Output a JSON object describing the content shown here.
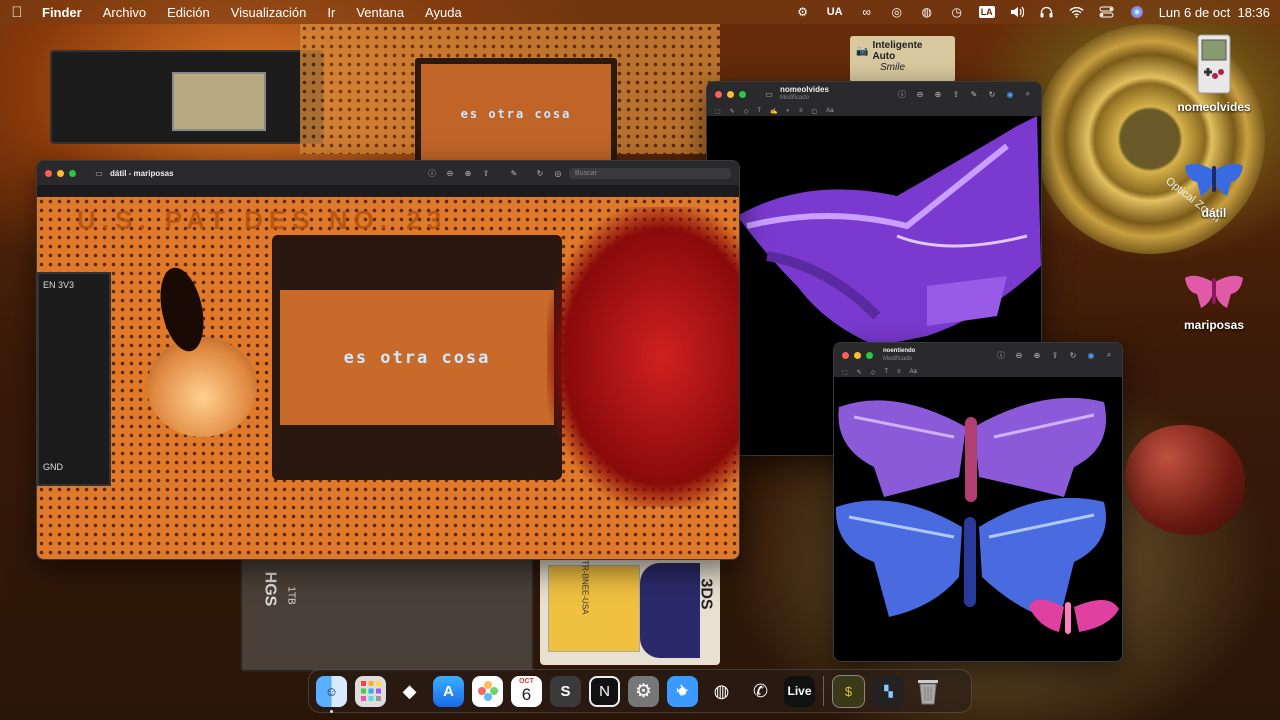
{
  "menubar": {
    "app": "Finder",
    "menus": [
      "Archivo",
      "Edición",
      "Visualización",
      "Ir",
      "Ventana",
      "Ayuda"
    ],
    "keyboard": "UA",
    "input_badge": "LA",
    "clock": "Lun 6 de oct  18:36",
    "status_icons": [
      "gear-icon",
      "input-source",
      "creative-cloud-icon",
      "airdrop-icon",
      "sony-icon",
      "time-machine-icon",
      "volume-icon",
      "headphones-icon",
      "wifi-icon",
      "control-center-icon",
      "siri-icon"
    ]
  },
  "scene": {
    "oled_small": "es otra cosa",
    "label_camera_1": "Inteligente",
    "label_camera_2": "Auto",
    "label_camera_3": "Smile",
    "label_zoom": "Optical Zoom",
    "label_3ds": "3DS",
    "label_hdd": "HGS",
    "label_hdd_cap": "1TB",
    "label_game": "CTR-BNEE-USA"
  },
  "window_main": {
    "title": "dátil - mariposas",
    "search_placeholder": "Buscar",
    "oled_text": "es otra cosa",
    "patent_text": "U.S. PAT DES NO. 23",
    "board_label": "EN 3V3",
    "board_label_2": "GND"
  },
  "window_nomeolvides": {
    "title": "nomeolvides",
    "subtitle": "Modificado"
  },
  "window_noentiendo": {
    "title": "noentiendo",
    "subtitle": "Modificado"
  },
  "desktop_icons": [
    {
      "label": "nomeolvides",
      "icon": "gameboy-icon"
    },
    {
      "label": "dátil",
      "icon": "blue-moth-icon"
    },
    {
      "label": "mariposas",
      "icon": "pink-moth-icon"
    }
  ],
  "dock": {
    "calendar_month": "OCT",
    "calendar_day": "6",
    "live_label": "Live",
    "apps": [
      "finder",
      "launchpad",
      "tidal",
      "app-store",
      "photos",
      "calendar",
      "sketchup",
      "nightshift",
      "system-settings",
      "safari",
      "spotify",
      "whatsapp",
      "ableton-live",
      "preview-image",
      "terminal-image",
      "trash"
    ]
  },
  "colors": {
    "accent_orange": "#d98a3a",
    "window_dark": "#1b1b1d",
    "moth_purple": "#8a5ad8",
    "moth_pink": "#e040a0"
  }
}
